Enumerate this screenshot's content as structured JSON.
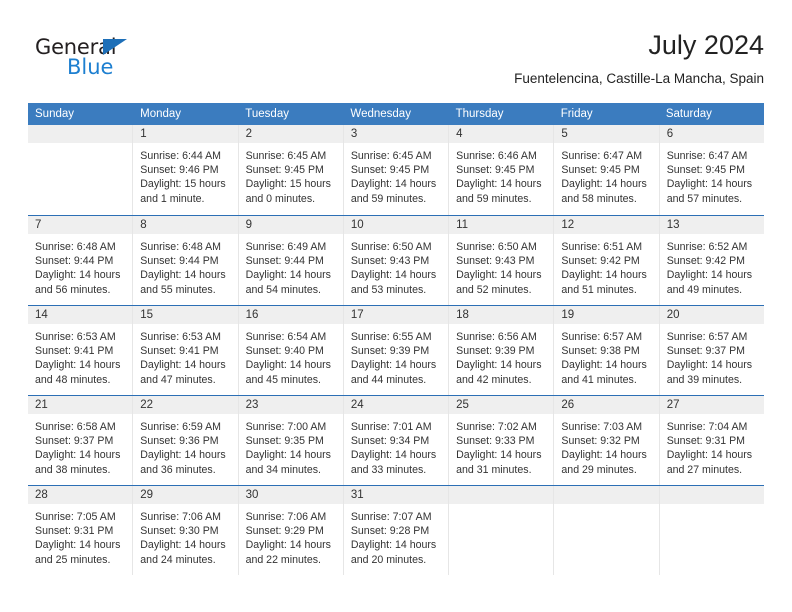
{
  "brand": {
    "name_part1": "General",
    "name_part2": "Blue",
    "triangle_color": "#1d6fb8",
    "blue_color": "#1d7fd0"
  },
  "header": {
    "title": "July 2024",
    "subtitle": "Fuentelencina, Castille-La Mancha, Spain"
  },
  "theme": {
    "header_bg": "#3b7cbf",
    "week_divider": "#2c6fb5",
    "daynum_band": "#efefef"
  },
  "weekdays": [
    "Sunday",
    "Monday",
    "Tuesday",
    "Wednesday",
    "Thursday",
    "Friday",
    "Saturday"
  ],
  "weeks": [
    [
      {
        "day": "",
        "sunrise": "",
        "sunset": "",
        "daylight1": "",
        "daylight2": ""
      },
      {
        "day": "1",
        "sunrise": "Sunrise: 6:44 AM",
        "sunset": "Sunset: 9:46 PM",
        "daylight1": "Daylight: 15 hours",
        "daylight2": "and 1 minute."
      },
      {
        "day": "2",
        "sunrise": "Sunrise: 6:45 AM",
        "sunset": "Sunset: 9:45 PM",
        "daylight1": "Daylight: 15 hours",
        "daylight2": "and 0 minutes."
      },
      {
        "day": "3",
        "sunrise": "Sunrise: 6:45 AM",
        "sunset": "Sunset: 9:45 PM",
        "daylight1": "Daylight: 14 hours",
        "daylight2": "and 59 minutes."
      },
      {
        "day": "4",
        "sunrise": "Sunrise: 6:46 AM",
        "sunset": "Sunset: 9:45 PM",
        "daylight1": "Daylight: 14 hours",
        "daylight2": "and 59 minutes."
      },
      {
        "day": "5",
        "sunrise": "Sunrise: 6:47 AM",
        "sunset": "Sunset: 9:45 PM",
        "daylight1": "Daylight: 14 hours",
        "daylight2": "and 58 minutes."
      },
      {
        "day": "6",
        "sunrise": "Sunrise: 6:47 AM",
        "sunset": "Sunset: 9:45 PM",
        "daylight1": "Daylight: 14 hours",
        "daylight2": "and 57 minutes."
      }
    ],
    [
      {
        "day": "7",
        "sunrise": "Sunrise: 6:48 AM",
        "sunset": "Sunset: 9:44 PM",
        "daylight1": "Daylight: 14 hours",
        "daylight2": "and 56 minutes."
      },
      {
        "day": "8",
        "sunrise": "Sunrise: 6:48 AM",
        "sunset": "Sunset: 9:44 PM",
        "daylight1": "Daylight: 14 hours",
        "daylight2": "and 55 minutes."
      },
      {
        "day": "9",
        "sunrise": "Sunrise: 6:49 AM",
        "sunset": "Sunset: 9:44 PM",
        "daylight1": "Daylight: 14 hours",
        "daylight2": "and 54 minutes."
      },
      {
        "day": "10",
        "sunrise": "Sunrise: 6:50 AM",
        "sunset": "Sunset: 9:43 PM",
        "daylight1": "Daylight: 14 hours",
        "daylight2": "and 53 minutes."
      },
      {
        "day": "11",
        "sunrise": "Sunrise: 6:50 AM",
        "sunset": "Sunset: 9:43 PM",
        "daylight1": "Daylight: 14 hours",
        "daylight2": "and 52 minutes."
      },
      {
        "day": "12",
        "sunrise": "Sunrise: 6:51 AM",
        "sunset": "Sunset: 9:42 PM",
        "daylight1": "Daylight: 14 hours",
        "daylight2": "and 51 minutes."
      },
      {
        "day": "13",
        "sunrise": "Sunrise: 6:52 AM",
        "sunset": "Sunset: 9:42 PM",
        "daylight1": "Daylight: 14 hours",
        "daylight2": "and 49 minutes."
      }
    ],
    [
      {
        "day": "14",
        "sunrise": "Sunrise: 6:53 AM",
        "sunset": "Sunset: 9:41 PM",
        "daylight1": "Daylight: 14 hours",
        "daylight2": "and 48 minutes."
      },
      {
        "day": "15",
        "sunrise": "Sunrise: 6:53 AM",
        "sunset": "Sunset: 9:41 PM",
        "daylight1": "Daylight: 14 hours",
        "daylight2": "and 47 minutes."
      },
      {
        "day": "16",
        "sunrise": "Sunrise: 6:54 AM",
        "sunset": "Sunset: 9:40 PM",
        "daylight1": "Daylight: 14 hours",
        "daylight2": "and 45 minutes."
      },
      {
        "day": "17",
        "sunrise": "Sunrise: 6:55 AM",
        "sunset": "Sunset: 9:39 PM",
        "daylight1": "Daylight: 14 hours",
        "daylight2": "and 44 minutes."
      },
      {
        "day": "18",
        "sunrise": "Sunrise: 6:56 AM",
        "sunset": "Sunset: 9:39 PM",
        "daylight1": "Daylight: 14 hours",
        "daylight2": "and 42 minutes."
      },
      {
        "day": "19",
        "sunrise": "Sunrise: 6:57 AM",
        "sunset": "Sunset: 9:38 PM",
        "daylight1": "Daylight: 14 hours",
        "daylight2": "and 41 minutes."
      },
      {
        "day": "20",
        "sunrise": "Sunrise: 6:57 AM",
        "sunset": "Sunset: 9:37 PM",
        "daylight1": "Daylight: 14 hours",
        "daylight2": "and 39 minutes."
      }
    ],
    [
      {
        "day": "21",
        "sunrise": "Sunrise: 6:58 AM",
        "sunset": "Sunset: 9:37 PM",
        "daylight1": "Daylight: 14 hours",
        "daylight2": "and 38 minutes."
      },
      {
        "day": "22",
        "sunrise": "Sunrise: 6:59 AM",
        "sunset": "Sunset: 9:36 PM",
        "daylight1": "Daylight: 14 hours",
        "daylight2": "and 36 minutes."
      },
      {
        "day": "23",
        "sunrise": "Sunrise: 7:00 AM",
        "sunset": "Sunset: 9:35 PM",
        "daylight1": "Daylight: 14 hours",
        "daylight2": "and 34 minutes."
      },
      {
        "day": "24",
        "sunrise": "Sunrise: 7:01 AM",
        "sunset": "Sunset: 9:34 PM",
        "daylight1": "Daylight: 14 hours",
        "daylight2": "and 33 minutes."
      },
      {
        "day": "25",
        "sunrise": "Sunrise: 7:02 AM",
        "sunset": "Sunset: 9:33 PM",
        "daylight1": "Daylight: 14 hours",
        "daylight2": "and 31 minutes."
      },
      {
        "day": "26",
        "sunrise": "Sunrise: 7:03 AM",
        "sunset": "Sunset: 9:32 PM",
        "daylight1": "Daylight: 14 hours",
        "daylight2": "and 29 minutes."
      },
      {
        "day": "27",
        "sunrise": "Sunrise: 7:04 AM",
        "sunset": "Sunset: 9:31 PM",
        "daylight1": "Daylight: 14 hours",
        "daylight2": "and 27 minutes."
      }
    ],
    [
      {
        "day": "28",
        "sunrise": "Sunrise: 7:05 AM",
        "sunset": "Sunset: 9:31 PM",
        "daylight1": "Daylight: 14 hours",
        "daylight2": "and 25 minutes."
      },
      {
        "day": "29",
        "sunrise": "Sunrise: 7:06 AM",
        "sunset": "Sunset: 9:30 PM",
        "daylight1": "Daylight: 14 hours",
        "daylight2": "and 24 minutes."
      },
      {
        "day": "30",
        "sunrise": "Sunrise: 7:06 AM",
        "sunset": "Sunset: 9:29 PM",
        "daylight1": "Daylight: 14 hours",
        "daylight2": "and 22 minutes."
      },
      {
        "day": "31",
        "sunrise": "Sunrise: 7:07 AM",
        "sunset": "Sunset: 9:28 PM",
        "daylight1": "Daylight: 14 hours",
        "daylight2": "and 20 minutes."
      },
      {
        "day": "",
        "sunrise": "",
        "sunset": "",
        "daylight1": "",
        "daylight2": ""
      },
      {
        "day": "",
        "sunrise": "",
        "sunset": "",
        "daylight1": "",
        "daylight2": ""
      },
      {
        "day": "",
        "sunrise": "",
        "sunset": "",
        "daylight1": "",
        "daylight2": ""
      }
    ]
  ]
}
